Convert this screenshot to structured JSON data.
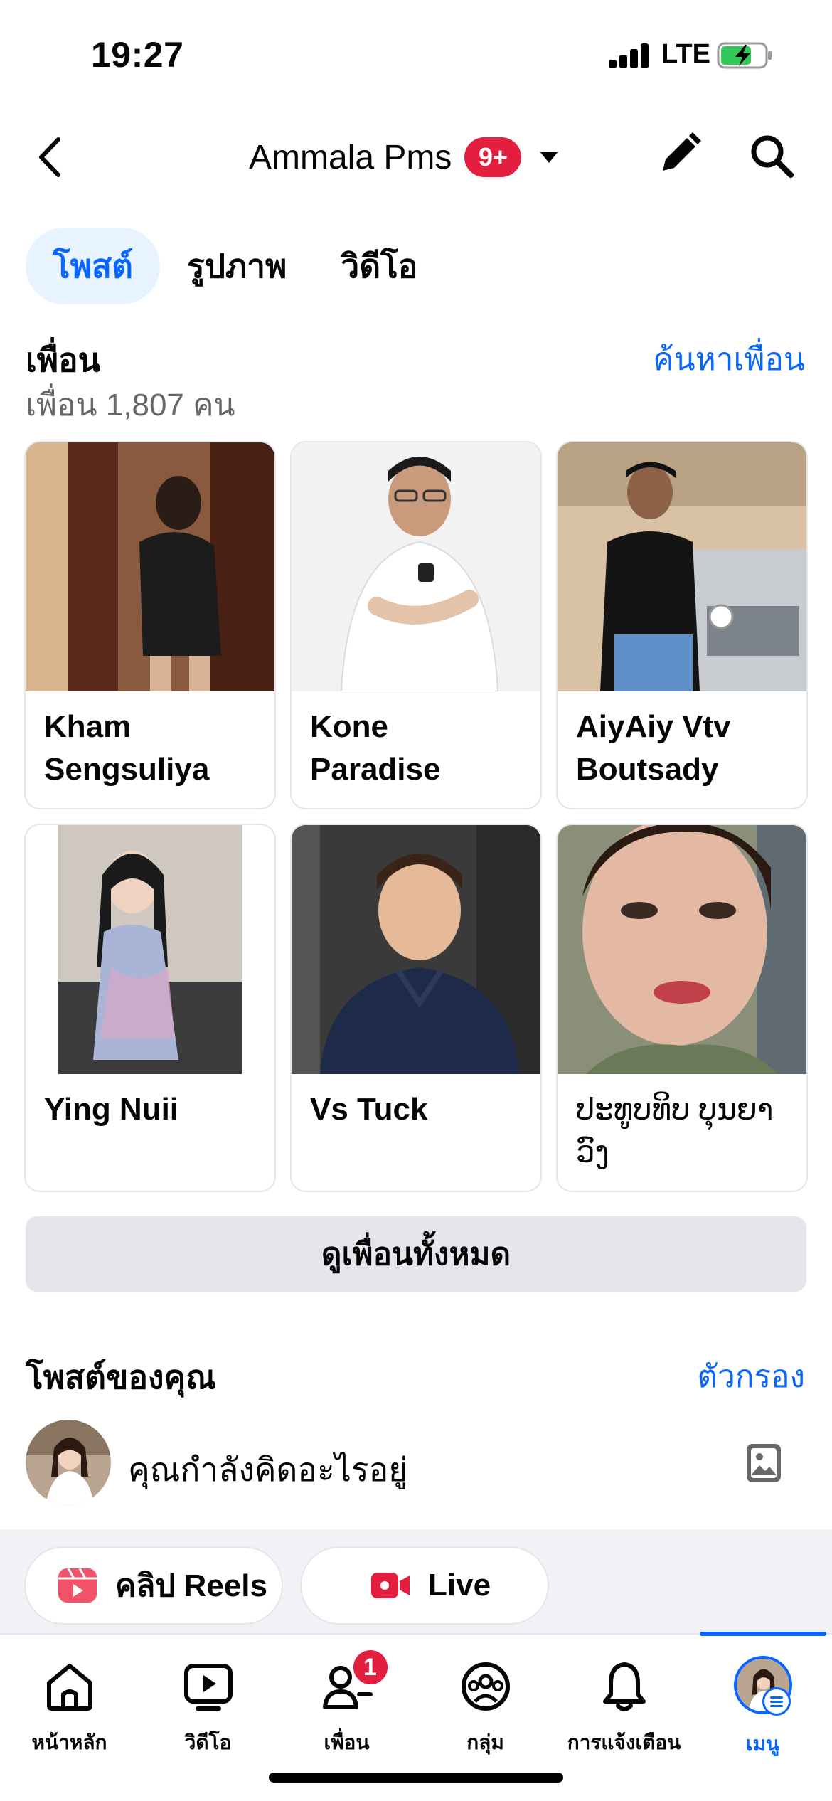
{
  "status_bar": {
    "time": "19:27",
    "network": "LTE",
    "battery_icon": "battery-charging-icon"
  },
  "header": {
    "title": "Ammala Pms",
    "badge": "9+"
  },
  "tabs": [
    {
      "label": "โพสต์",
      "active": true
    },
    {
      "label": "รูปภาพ",
      "active": false
    },
    {
      "label": "วิดีโอ",
      "active": false
    }
  ],
  "friends": {
    "title": "เพื่อน",
    "count": "เพื่อน 1,807 คน",
    "find_link": "ค้นหาเพื่อน",
    "cards": [
      {
        "name": "Kham Sengsuliya"
      },
      {
        "name": "Kone Paradise"
      },
      {
        "name": "AiyAiy Vtv Boutsady"
      },
      {
        "name": "Ying Nuii"
      },
      {
        "name": "Vs Tuck"
      },
      {
        "name": "ປະທູບທິບ ບຸນຍາ ວົງ"
      }
    ],
    "see_all": "ดูเพื่อนทั้งหมด"
  },
  "posts": {
    "title": "โพสต์ของคุณ",
    "filter": "ตัวกรอง",
    "composer_placeholder": "คุณกำลังคิดอะไรอยู่",
    "reels_label": "คลิป Reels",
    "live_label": "Live"
  },
  "bottom_nav": {
    "items": [
      {
        "label": "หน้าหลัก",
        "icon": "home-icon"
      },
      {
        "label": "วิดีโอ",
        "icon": "video-icon"
      },
      {
        "label": "เพื่อน",
        "icon": "friends-icon",
        "badge": "1"
      },
      {
        "label": "กลุ่ม",
        "icon": "groups-icon"
      },
      {
        "label": "การแจ้งเตือน",
        "icon": "bell-icon"
      },
      {
        "label": "เมนู",
        "icon": "menu-avatar-icon",
        "active": true
      }
    ]
  },
  "colors": {
    "accent": "#0866ff",
    "badge": "#e41e3f",
    "tab_active_bg": "#e7f3ff",
    "button_bg": "#e4e6eb"
  }
}
